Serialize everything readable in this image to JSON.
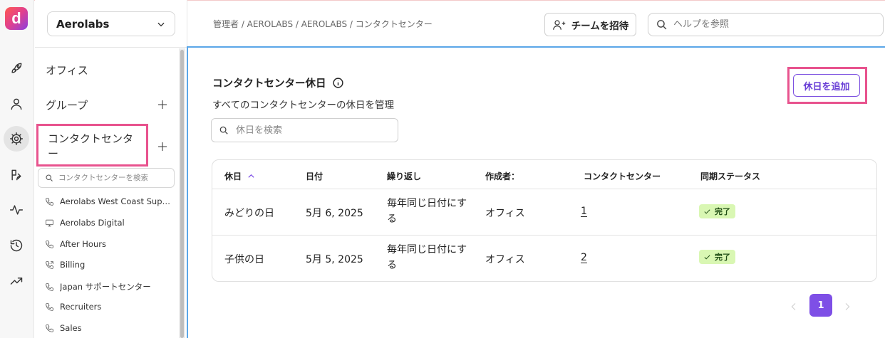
{
  "app": {
    "logo_letter": "d",
    "accent_color": "#7e4fe6",
    "highlight_color": "#e8538e"
  },
  "rail": {
    "icons": [
      "rocket-icon",
      "user-icon",
      "gear-icon",
      "routing-icon",
      "activity-icon",
      "history-icon",
      "trending-icon"
    ],
    "active": "gear-icon"
  },
  "sidebar": {
    "org_name": "Aerolabs",
    "items": [
      {
        "label": "オフィス"
      },
      {
        "label": "グループ"
      },
      {
        "label": "コンタクトセンター"
      }
    ],
    "search_placeholder": "コンタクトセンターを検索",
    "contact_centers": [
      {
        "label": "Aerolabs West Coast Support",
        "icon": "phone-icon"
      },
      {
        "label": "Aerolabs Digital",
        "icon": "monitor-icon"
      },
      {
        "label": "After Hours",
        "icon": "phone-icon"
      },
      {
        "label": "Billing",
        "icon": "phone-transfer-icon"
      },
      {
        "label": "Japan サポートセンター",
        "icon": "phone-icon"
      },
      {
        "label": "Recruiters",
        "icon": "phone-icon"
      },
      {
        "label": "Sales",
        "icon": "phone-icon"
      }
    ]
  },
  "header": {
    "breadcrumb": "管理者 / AEROLABS / AEROLABS / コンタクトセンター",
    "invite_label": "チームを招待",
    "help_placeholder": "ヘルプを参照"
  },
  "main": {
    "title": "コンタクトセンター休日",
    "subtitle": "すべてのコンタクトセンターの休日を管理",
    "add_button": "休日を追加",
    "search_placeholder": "休日を検索",
    "table": {
      "headers": [
        "休日",
        "日付",
        "繰り返し",
        "作成者：",
        "コンタクトセンター",
        "同期ステータス"
      ],
      "rows": [
        {
          "name": "みどりの日",
          "date": "5月 6, 2025",
          "repeat": "毎年同じ日付にする",
          "creator": "オフィス",
          "centers": "1",
          "status": "完了"
        },
        {
          "name": "子供の日",
          "date": "5月 5, 2025",
          "repeat": "毎年同じ日付にする",
          "creator": "オフィス",
          "centers": "2",
          "status": "完了"
        }
      ]
    },
    "pagination": {
      "current_page": "1"
    }
  }
}
